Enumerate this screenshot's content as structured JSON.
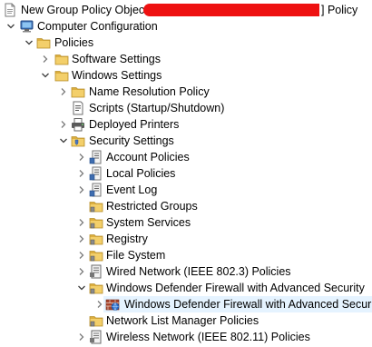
{
  "title": {
    "prefix": "New Group Policy Object [",
    "suffix": "] Policy"
  },
  "tree": [
    {
      "label": "Computer Configuration",
      "icon": "computer-icon",
      "expanded": true
    },
    {
      "label": "Policies",
      "icon": "folder-icon",
      "expanded": true
    },
    {
      "label": "Software Settings",
      "icon": "folder-icon",
      "expanded": false
    },
    {
      "label": "Windows Settings",
      "icon": "folder-icon",
      "expanded": true
    },
    {
      "label": "Name Resolution Policy",
      "icon": "folder-icon",
      "expanded": false
    },
    {
      "label": "Scripts (Startup/Shutdown)",
      "icon": "script-icon"
    },
    {
      "label": "Deployed Printers",
      "icon": "printer-icon",
      "expanded": false
    },
    {
      "label": "Security Settings",
      "icon": "security-icon",
      "expanded": true
    },
    {
      "label": "Account Policies",
      "icon": "policy-icon",
      "expanded": false
    },
    {
      "label": "Local Policies",
      "icon": "policy-icon",
      "expanded": false
    },
    {
      "label": "Event Log",
      "icon": "policy-icon",
      "expanded": false
    },
    {
      "label": "Restricted Groups",
      "icon": "shield-folder-icon"
    },
    {
      "label": "System Services",
      "icon": "shield-folder-icon",
      "expanded": false
    },
    {
      "label": "Registry",
      "icon": "shield-folder-icon",
      "expanded": false
    },
    {
      "label": "File System",
      "icon": "shield-folder-icon",
      "expanded": false
    },
    {
      "label": "Wired Network (IEEE 802.3) Policies",
      "icon": "network-policy-icon",
      "expanded": false
    },
    {
      "label": "Windows Defender Firewall with Advanced Security",
      "icon": "shield-folder-icon",
      "expanded": true
    },
    {
      "label": "Windows Defender Firewall with Advanced Security",
      "icon": "firewall-icon",
      "expanded": false,
      "selected": true
    },
    {
      "label": "Network List Manager Policies",
      "icon": "shield-folder-icon"
    },
    {
      "label": "Wireless Network (IEEE 802.11) Policies",
      "icon": "network-policy-icon",
      "expanded": false
    }
  ],
  "colors": {
    "selection": "#e5f3ff",
    "folder": "#e8b94a",
    "redaction": "#ee1111"
  }
}
